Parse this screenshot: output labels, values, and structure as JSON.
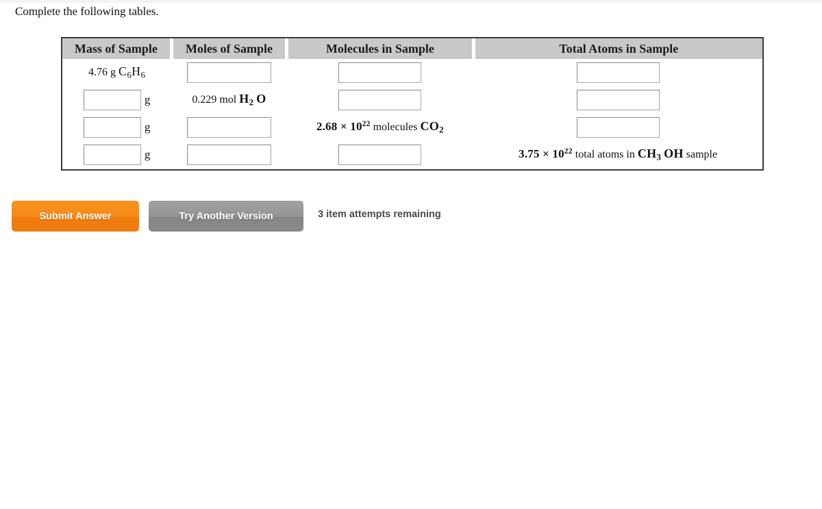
{
  "prompt": "Complete the following tables.",
  "table": {
    "headers": [
      "Mass of Sample",
      "Moles of Sample",
      "Molecules in Sample",
      "Total Atoms in Sample"
    ],
    "rows": [
      {
        "mass": {
          "type": "given",
          "value": "4.76 g C6H6",
          "number": "4.76",
          "unit": "g",
          "formula": "C6H6"
        },
        "moles": {
          "type": "input",
          "value": "",
          "placeholder": ""
        },
        "molecules": {
          "type": "input",
          "value": "",
          "placeholder": ""
        },
        "atoms": {
          "type": "input",
          "value": "",
          "placeholder": ""
        }
      },
      {
        "mass": {
          "type": "input",
          "value": "",
          "placeholder": "",
          "unit": "g"
        },
        "moles": {
          "type": "given",
          "value": "0.229 mol H2O",
          "number": "0.229",
          "unit": "mol",
          "formula": "H2O"
        },
        "molecules": {
          "type": "input",
          "value": "",
          "placeholder": ""
        },
        "atoms": {
          "type": "input",
          "value": "",
          "placeholder": ""
        }
      },
      {
        "mass": {
          "type": "input",
          "value": "",
          "placeholder": "",
          "unit": "g"
        },
        "moles": {
          "type": "input",
          "value": "",
          "placeholder": ""
        },
        "molecules": {
          "type": "given",
          "value": "2.68 x 10^22 molecules CO2",
          "mantissa": "2.68",
          "exponent": "22",
          "label": "molecules",
          "formula": "CO2"
        },
        "atoms": {
          "type": "input",
          "value": "",
          "placeholder": ""
        }
      },
      {
        "mass": {
          "type": "input",
          "value": "",
          "placeholder": "",
          "unit": "g"
        },
        "moles": {
          "type": "input",
          "value": "",
          "placeholder": ""
        },
        "molecules": {
          "type": "input",
          "value": "",
          "placeholder": ""
        },
        "atoms": {
          "type": "given",
          "value": "3.75 x 10^22 total atoms in CH3OH sample",
          "mantissa": "3.75",
          "exponent": "22",
          "label": "total atoms in",
          "formula": "CH3 OH",
          "suffix": "sample"
        }
      }
    ]
  },
  "footer": {
    "submit_label": "Submit Answer",
    "try_another_label": "Try Another Version",
    "attempts_text": "3 item attempts remaining",
    "attempts_count": "3"
  },
  "colors": {
    "submit_orange": "#f7941d",
    "try_gray": "#949494",
    "header_gray": "#c9c9c9",
    "table_border": "#3a3a3a",
    "page_background": "#ffffff"
  }
}
